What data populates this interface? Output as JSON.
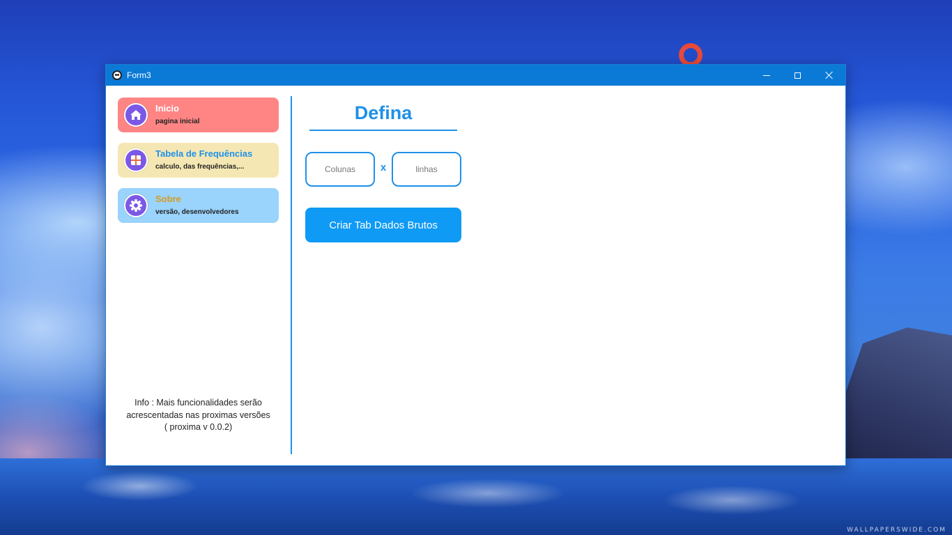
{
  "window": {
    "title": "Form3",
    "icon": "app-face-icon"
  },
  "sidebar": {
    "items": [
      {
        "title": "Inicio",
        "subtitle": "pagina inicial",
        "icon": "home-icon",
        "color": "#ff8585",
        "title_color": "#ffffff"
      },
      {
        "title": "Tabela de Frequências",
        "subtitle": "calculo, das frequências,...",
        "icon": "table-icon",
        "color": "#f5e7b3",
        "title_color": "#1e90e8"
      },
      {
        "title": "Sobre",
        "subtitle": "versão, desenvolvedores",
        "icon": "gear-icon",
        "color": "#9ad3fb",
        "title_color": "#d79b1f"
      }
    ],
    "info": {
      "line1": "Info : Mais funcionalidades serão",
      "line2": "acrescentadas nas proximas versões",
      "line3": "( proxima v 0.0.2)"
    }
  },
  "main": {
    "heading": "Defina",
    "columns_placeholder": "Colunas",
    "rows_placeholder": "linhas",
    "separator": "x",
    "create_button": "Criar Tab Dados Brutos"
  },
  "desktop": {
    "watermark": "WALLPAPERSWIDE.COM"
  },
  "colors": {
    "accent": "#1e90e8",
    "titlebar": "#0b7ad6",
    "button": "#0f9af5",
    "icon_circle": "#7b58e6"
  }
}
